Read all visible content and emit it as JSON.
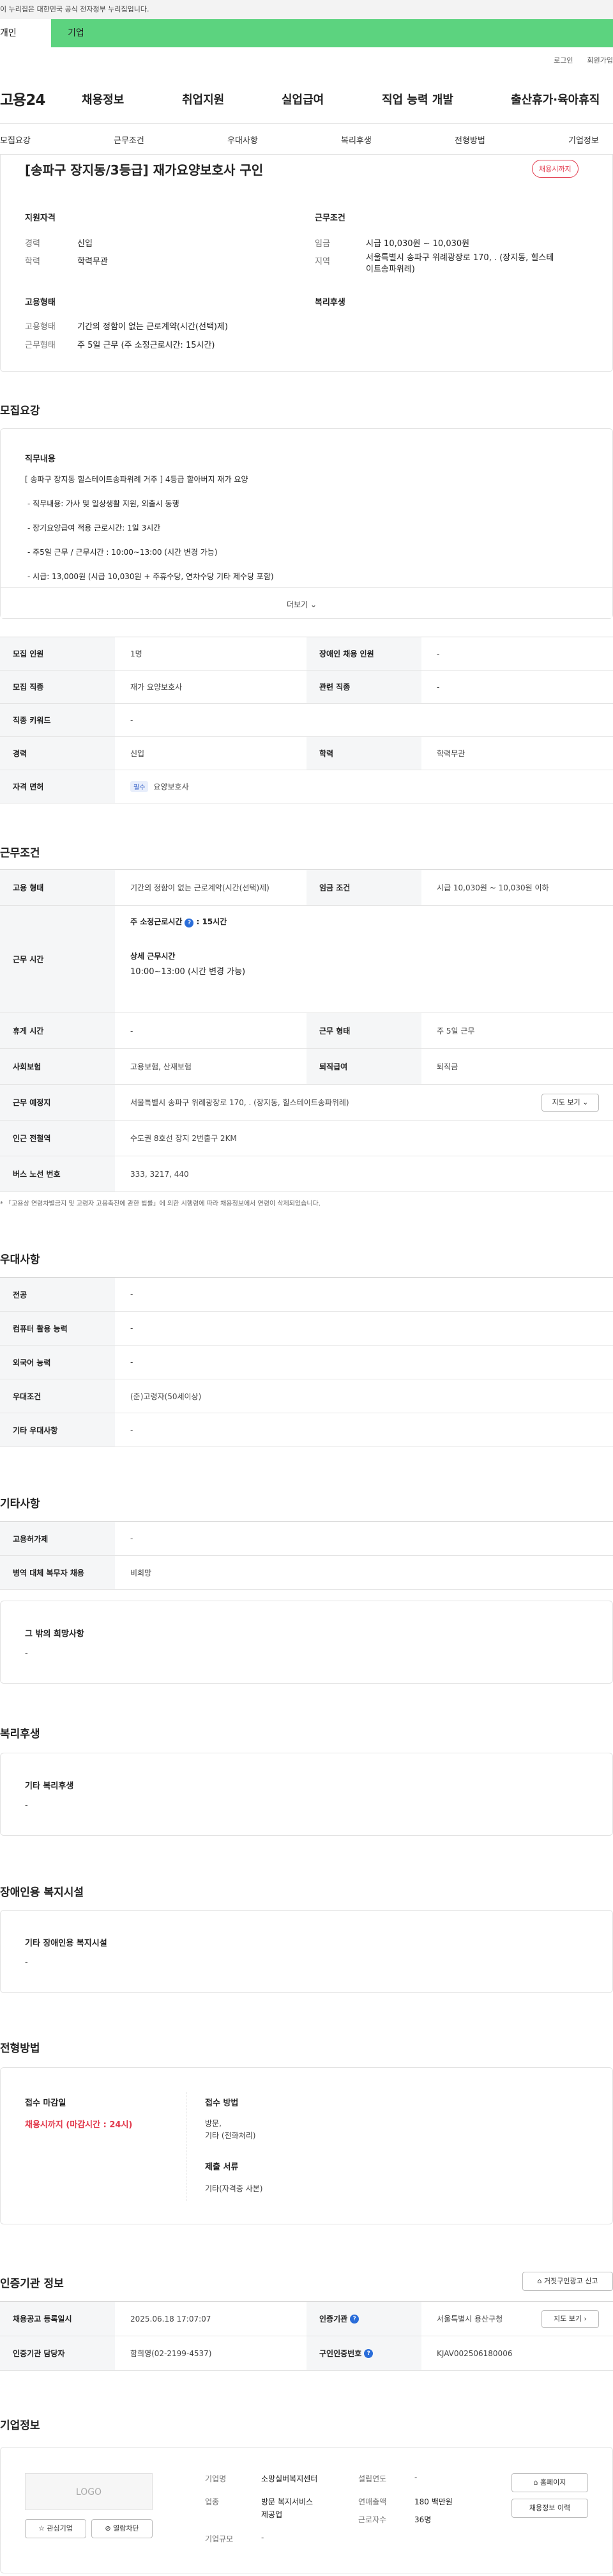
{
  "gov_banner": "이 누리집은 대한민국 공식 전자정부 누리집입니다.",
  "user_tabs": [
    "개인",
    "기업"
  ],
  "util": [
    "로그인",
    "회원가입"
  ],
  "gnb": {
    "logo": "고용24",
    "menus": [
      "채용정보",
      "취업지원",
      "실업급여",
      "직업 능력 개발",
      "출산휴가·육아휴직"
    ]
  },
  "lnb": [
    "모집요강",
    "근무조건",
    "우대사항",
    "복리후생",
    "전형방법",
    "기업정보"
  ],
  "summary": {
    "title": "[송파구 장지동/3등급] 재가요양보호사 구인",
    "deadline_badge": "채용시까지",
    "qual_heading": "지원자격",
    "career_label": "경력",
    "career_value": "신입",
    "edu_label": "학력",
    "edu_value": "학력무관",
    "cond_heading": "근무조건",
    "wage_label": "임금",
    "wage_value": "시급 10,030원 ~ 10,030원",
    "region_label": "지역",
    "region_value_1": "서울특별시 송파구 위례광장로 170, . (장지동, 힐스테",
    "region_value_2": "이트송파위례)",
    "emp_heading": "고용형태",
    "emp_type_label": "고용형태",
    "emp_type_value": "기간의 정함이 없는 근로계약(시간(선택)제)",
    "work_type_label": "근무형태",
    "work_type_value": "주 5일 근무 (주 소정근로시간: 15시간)",
    "welfare_heading": "복리후생"
  },
  "recruit": {
    "heading": "모집요강",
    "job_heading": "직무내용",
    "lines": [
      "[ 송파구 장지동 힐스테이트송파위례 거주 ] 4등급 할아버지 재가 요양",
      "- 직무내용: 가사 및 일상생활 지원, 외출시 동행",
      "- 장기요양급여 적용 근로시간: 1일 3시간",
      "- 주5일 근무 / 근무시간 : 10:00~13:00 (시간 변경 가능)",
      "- 시급: 13,000원 (시급 10,030원 + 주휴수당, 연차수당 기타 제수당 포함)"
    ],
    "more": "더보기",
    "table": {
      "r1": [
        "모집 인원",
        "1명",
        "장애인 채용 인원",
        "-"
      ],
      "r2": [
        "모집 직종",
        "재가 요양보호사",
        "관련 직종",
        "-"
      ],
      "r3": [
        "직종 키워드",
        "-"
      ],
      "r4": [
        "경력",
        "신입",
        "학력",
        "학력무관"
      ],
      "r5_label": "자격 면허",
      "r5_badge": "필수",
      "r5_value": "요양보호사"
    }
  },
  "cond": {
    "heading": "근무조건",
    "r1": [
      "고용 형태",
      "기간의 정함이 없는 근로계약(시간(선택)제)",
      "임금 조건",
      "시급 10,030원 ~ 10,030원 이하"
    ],
    "time_label": "근무 시간",
    "time_weekly_label": "주 소정근로시간",
    "time_weekly_value": ": 15시간",
    "time_detail_label": "상세 근무시간",
    "time_detail_value": "10:00~13:00 (시간 변경 가능)",
    "r3": [
      "휴게 시간",
      "-",
      "근무 형태",
      "주 5일 근무"
    ],
    "r4": [
      "사회보험",
      "고용보험, 산재보험",
      "퇴직급여",
      "퇴직금"
    ],
    "r5": [
      "근무 예정지",
      "서울특별시 송파구 위례광장로 170, . (장지동, 힐스테이트송파위례)"
    ],
    "map_button": "지도 보기",
    "r6": [
      "인근 전철역",
      "수도권 8호선 장지 2번출구 2KM"
    ],
    "r7": [
      "버스 노선 번호",
      "333, 3217, 440"
    ],
    "note": "* 「고용상 연령차별금지 및 고령자 고용촉진에 관한 법률」에 의한 시행령에 따라 채용정보에서 연령이 삭제되었습니다."
  },
  "pref": {
    "heading": "우대사항",
    "rows": [
      [
        "전공",
        "-"
      ],
      [
        "컴퓨터 활용 능력",
        "-"
      ],
      [
        "외국어 능력",
        "-"
      ],
      [
        "우대조건",
        "(준)고령자(50세이상)"
      ],
      [
        "기타 우대사항",
        "-"
      ]
    ]
  },
  "etc": {
    "heading": "기타사항",
    "rows": [
      [
        "고용허가제",
        "-"
      ],
      [
        "병역 대체 복무자 채용",
        "비희망"
      ]
    ],
    "wish_heading": "그 밖의 희망사항",
    "wish_value": "-"
  },
  "welfare": {
    "heading": "복리후생",
    "sub": "기타 복리후생",
    "value": "-"
  },
  "disabled": {
    "heading": "장애인용 복지시설",
    "sub": "기타 장애인용 복지시설",
    "value": "-"
  },
  "process": {
    "heading": "전형방법",
    "deadline_label": "접수 마감일",
    "deadline_value": "채용시까지 (마감시간 : 24시)",
    "method_label": "접수 방법",
    "method_1": "방문,",
    "method_2": "기타 (전화처리)",
    "docs_label": "제출 서류",
    "docs_value": "기타(자격증 사본)"
  },
  "cert": {
    "heading": "인증기관 정보",
    "report_button": "거짓구인광고 신고",
    "r1": [
      "채용공고 등록일시",
      "2025.06.18 17:07:07",
      "인증기관",
      "서울특별시 용산구청"
    ],
    "map_button": "지도 보기",
    "r2": [
      "인증기관 담당자",
      "함희영(02-2199-4537)",
      "구인인증번호",
      "KJAV002506180006"
    ]
  },
  "company": {
    "heading": "기업정보",
    "logo": "LOGO",
    "interest_button": "관심기업",
    "block_button": "열람차단",
    "name_label": "기업명",
    "name_value": "소망실버복지센터",
    "industry_label": "업종",
    "industry_value_1": "방문 복지서비스",
    "industry_value_2": "제공업",
    "scale_label": "기업규모",
    "scale_value": "-",
    "founded_label": "설립연도",
    "founded_value": "-",
    "sales_label": "연매출액",
    "sales_value": "180 백만원",
    "employees_label": "근로자수",
    "employees_value": "36명",
    "homepage_button": "홈페이지",
    "jobs_button": "채용정보 이력"
  }
}
